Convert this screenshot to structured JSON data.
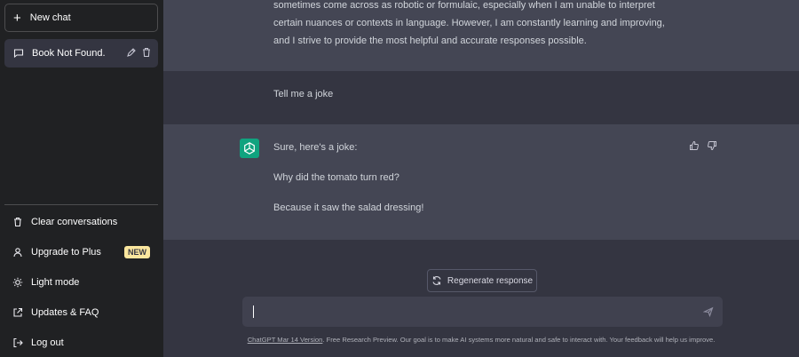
{
  "sidebar": {
    "new_chat_label": "New chat",
    "conversations": [
      {
        "title": "Book Not Found."
      }
    ],
    "menu": {
      "clear": "Clear conversations",
      "upgrade": "Upgrade to Plus",
      "upgrade_badge": "NEW",
      "light_mode": "Light mode",
      "updates": "Updates & FAQ",
      "logout": "Log out"
    }
  },
  "messages": {
    "prev_assistant_tail": [
      "sometimes come across as robotic or formulaic, especially when I am unable to interpret",
      "certain nuances or contexts in language. However, I am constantly learning and improving,",
      "and I strive to provide the most helpful and accurate responses possible."
    ],
    "user": "Tell me a joke",
    "assistant": {
      "line1": "Sure, here's a joke:",
      "line2": "Why did the tomato turn red?",
      "line3": "Because it saw the salad dressing!"
    }
  },
  "regenerate_label": "Regenerate response",
  "composer": {
    "placeholder": ""
  },
  "footer": {
    "version_link": "ChatGPT Mar 14 Version",
    "text": ". Free Research Preview. Our goal is to make AI systems more natural and safe to interact with. Your feedback will help us improve."
  },
  "colors": {
    "sidebar_bg": "#202123",
    "main_bg": "#343541",
    "assistant_bg": "#444654",
    "accent": "#10a37f",
    "badge": "#fae69e"
  },
  "icons": [
    "plus-icon",
    "chat-bubble-icon",
    "edit-icon",
    "trash-icon",
    "user-icon",
    "sun-icon",
    "external-link-icon",
    "logout-icon",
    "openai-logo-icon",
    "thumbs-up-icon",
    "thumbs-down-icon",
    "refresh-icon",
    "send-icon"
  ]
}
